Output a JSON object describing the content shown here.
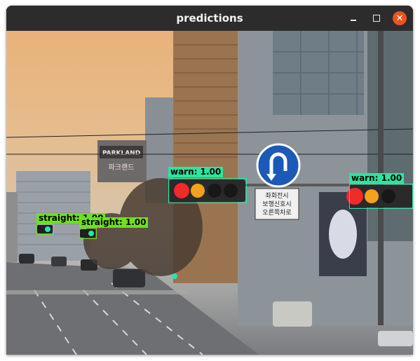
{
  "window": {
    "title": "predictions"
  },
  "scene": {
    "signs": {
      "korean_sign_line1": "파크랜드",
      "korean_sign_line2": "PARKLAND",
      "info_sign_line1": "좌회전시",
      "info_sign_line2": "보행신호시",
      "info_sign_line3": "오른쪽차로"
    }
  },
  "detections": [
    {
      "class": "warn",
      "score": "1.00",
      "label": "warn: 1.00",
      "color": "#2de4a0"
    },
    {
      "class": "warn",
      "score": "1.00",
      "label": "warn: 1.00",
      "color": "#2de4a0"
    },
    {
      "class": "straight",
      "score": "1.00",
      "label": "straight: 1.00",
      "color": "#6ce21a"
    },
    {
      "class": "straight",
      "score": "1.00",
      "label": "straight: 1.00",
      "color": "#6ce21a"
    }
  ]
}
